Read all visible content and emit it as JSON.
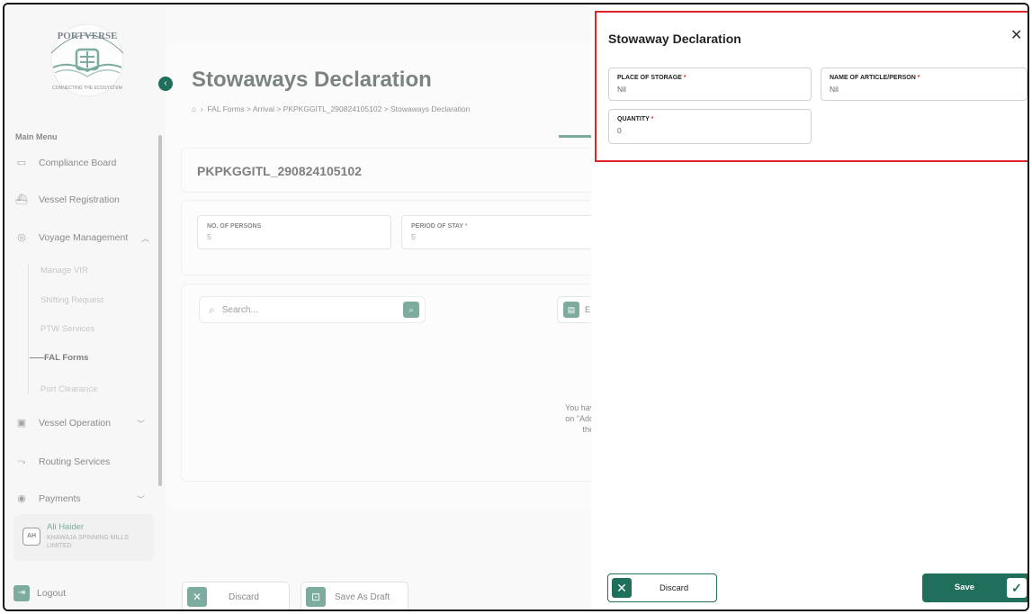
{
  "sidebar": {
    "logo_text": "PORTVERSE",
    "logo_tagline": "CONNECTING THE ECOSYSTEM",
    "menu_title": "Main Menu",
    "items": [
      {
        "label": "Compliance Board",
        "icon": "clipboard-icon"
      },
      {
        "label": "Vessel Registration",
        "icon": "ship-icon"
      },
      {
        "label": "Voyage Management",
        "icon": "compass-icon",
        "chevron": "^"
      },
      {
        "label": "Vessel Operation",
        "icon": "container-icon",
        "chevron": "v"
      },
      {
        "label": "Routing Services",
        "icon": "route-icon"
      },
      {
        "label": "Payments",
        "icon": "coin-icon",
        "chevron": "v"
      }
    ],
    "sub_items": [
      "Manage VIR",
      "Shifting Request",
      "PTW Services",
      "FAL Forms",
      "Port Clearance"
    ],
    "active_sub": "FAL Forms",
    "user": {
      "initials": "AH",
      "name": "Ali Haider",
      "org": "KHAWAJA SPINNING MILLS LIMITED"
    },
    "logout_label": "Logout"
  },
  "main": {
    "title": "Stowaways Declaration",
    "breadcrumb": "FAL Forms  >  Arrival  >  PKPKGGITL_290824105102  >  Stowaways Declaration",
    "record_id": "PKPKGGITL_290824105102",
    "fields": [
      {
        "label": "NO. OF PERSONS",
        "value": "5",
        "required": ""
      },
      {
        "label": "PERIOD OF STAY",
        "value": "5",
        "required": "*"
      }
    ],
    "search_placeholder": "Search...",
    "excel_label": "E",
    "empty_lines": [
      "You haven't added",
      "on \"Add New\" or u",
      "the Stow"
    ],
    "discard_label": "Discard",
    "save_draft_label": "Save As Draft"
  },
  "drawer": {
    "title": "Stowaway Declaration",
    "close_glyph": "✕",
    "fields": [
      {
        "label": "PLACE OF STORAGE",
        "value": "Nil",
        "required": "*"
      },
      {
        "label": "NAME OF ARTICLE/PERSON",
        "value": "Nil",
        "required": "*"
      },
      {
        "label": "QUANTITY",
        "value": "0",
        "required": "*"
      }
    ],
    "discard_label": "Discard",
    "save_label": "Save"
  },
  "colors": {
    "accent": "#1f6f5c",
    "highlight": "#e0242a"
  }
}
